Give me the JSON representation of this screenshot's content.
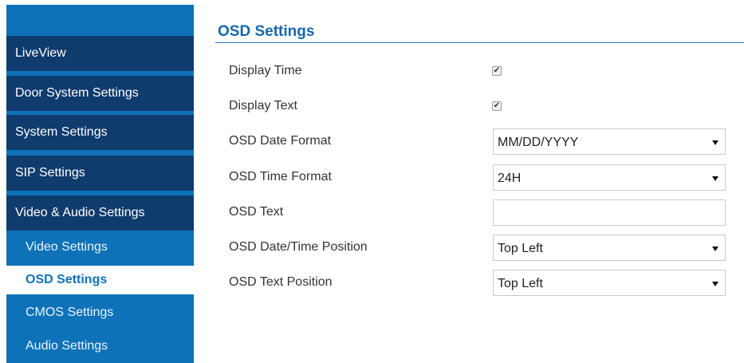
{
  "sidebar": {
    "main_items": [
      {
        "label": "LiveView"
      },
      {
        "label": "Door System Settings"
      },
      {
        "label": "System Settings"
      },
      {
        "label": "SIP Settings"
      },
      {
        "label": "Video & Audio Settings"
      }
    ],
    "sub_items": [
      {
        "label": "Video Settings",
        "active": false
      },
      {
        "label": "OSD Settings",
        "active": true
      },
      {
        "label": "CMOS Settings",
        "active": false
      },
      {
        "label": "Audio Settings",
        "active": false
      }
    ]
  },
  "main": {
    "title": "OSD Settings",
    "rows": {
      "display_time": {
        "label": "Display Time",
        "checked": true
      },
      "display_text": {
        "label": "Display Text",
        "checked": true
      },
      "date_format": {
        "label": "OSD Date Format",
        "value": "MM/DD/YYYY"
      },
      "time_format": {
        "label": "OSD Time Format",
        "value": "24H"
      },
      "osd_text": {
        "label": "OSD Text",
        "value": "",
        "placeholder": ""
      },
      "datetime_position": {
        "label": "OSD Date/Time Position",
        "value": "Top Left"
      },
      "text_position": {
        "label": "OSD Text Position",
        "value": "Top Left"
      }
    }
  },
  "icons": {
    "check": "check-icon",
    "dropdown": "chevron-down-icon"
  },
  "colors": {
    "sidebar_bg": "#0e72b9",
    "nav_main_bg": "#0f3b6d",
    "active_sub_bg": "#ffffff",
    "active_sub_text": "#0e72b9",
    "title": "#1667b0"
  }
}
